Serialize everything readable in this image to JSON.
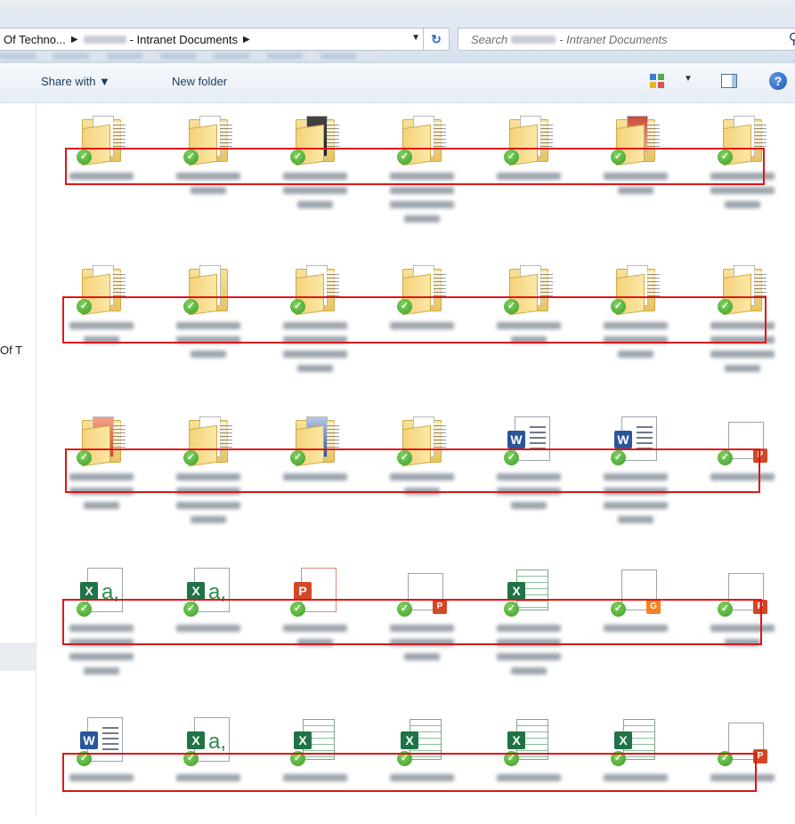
{
  "address": {
    "segment_1": "Of Techno...",
    "separator": "▶",
    "segment_2": "- Intranet Documents",
    "dropdown": "▼",
    "refresh": "↻"
  },
  "search": {
    "placeholder_prefix": "Search",
    "placeholder_suffix": "- Intranet Documents",
    "icon": "search-icon"
  },
  "toolbar": {
    "share_label": "Share with ▼",
    "new_folder_label": "New folder",
    "help": "?"
  },
  "navpane": {
    "visible_label": "Of T"
  },
  "check": "✓",
  "colors": {
    "highlight": "#e11515",
    "sync_check": "#3d9b2a",
    "word": "#2a5699",
    "excel": "#207346",
    "powerpoint": "#d24726"
  },
  "rows": [
    {
      "items": [
        "folder",
        "folder",
        "folder-photo",
        "folder",
        "folder",
        "folder-magazine",
        "folder"
      ]
    },
    {
      "items": [
        "folder",
        "folder-blank",
        "folder",
        "folder",
        "folder",
        "folder",
        "folder"
      ]
    },
    {
      "items": [
        "folder-ppt",
        "folder",
        "folder-doc",
        "folder",
        "word-doc",
        "word-doc",
        "ppt-file"
      ]
    },
    {
      "items": [
        "excel-a",
        "excel-a",
        "ppt-doc",
        "ppt-file",
        "excel-sheet",
        "pdf-file",
        "ppt-file"
      ]
    },
    {
      "items": [
        "word-doc",
        "excel-a",
        "excel-sheet",
        "excel-sheet",
        "excel-sheet",
        "excel-sheet",
        "ppt-file"
      ]
    }
  ]
}
